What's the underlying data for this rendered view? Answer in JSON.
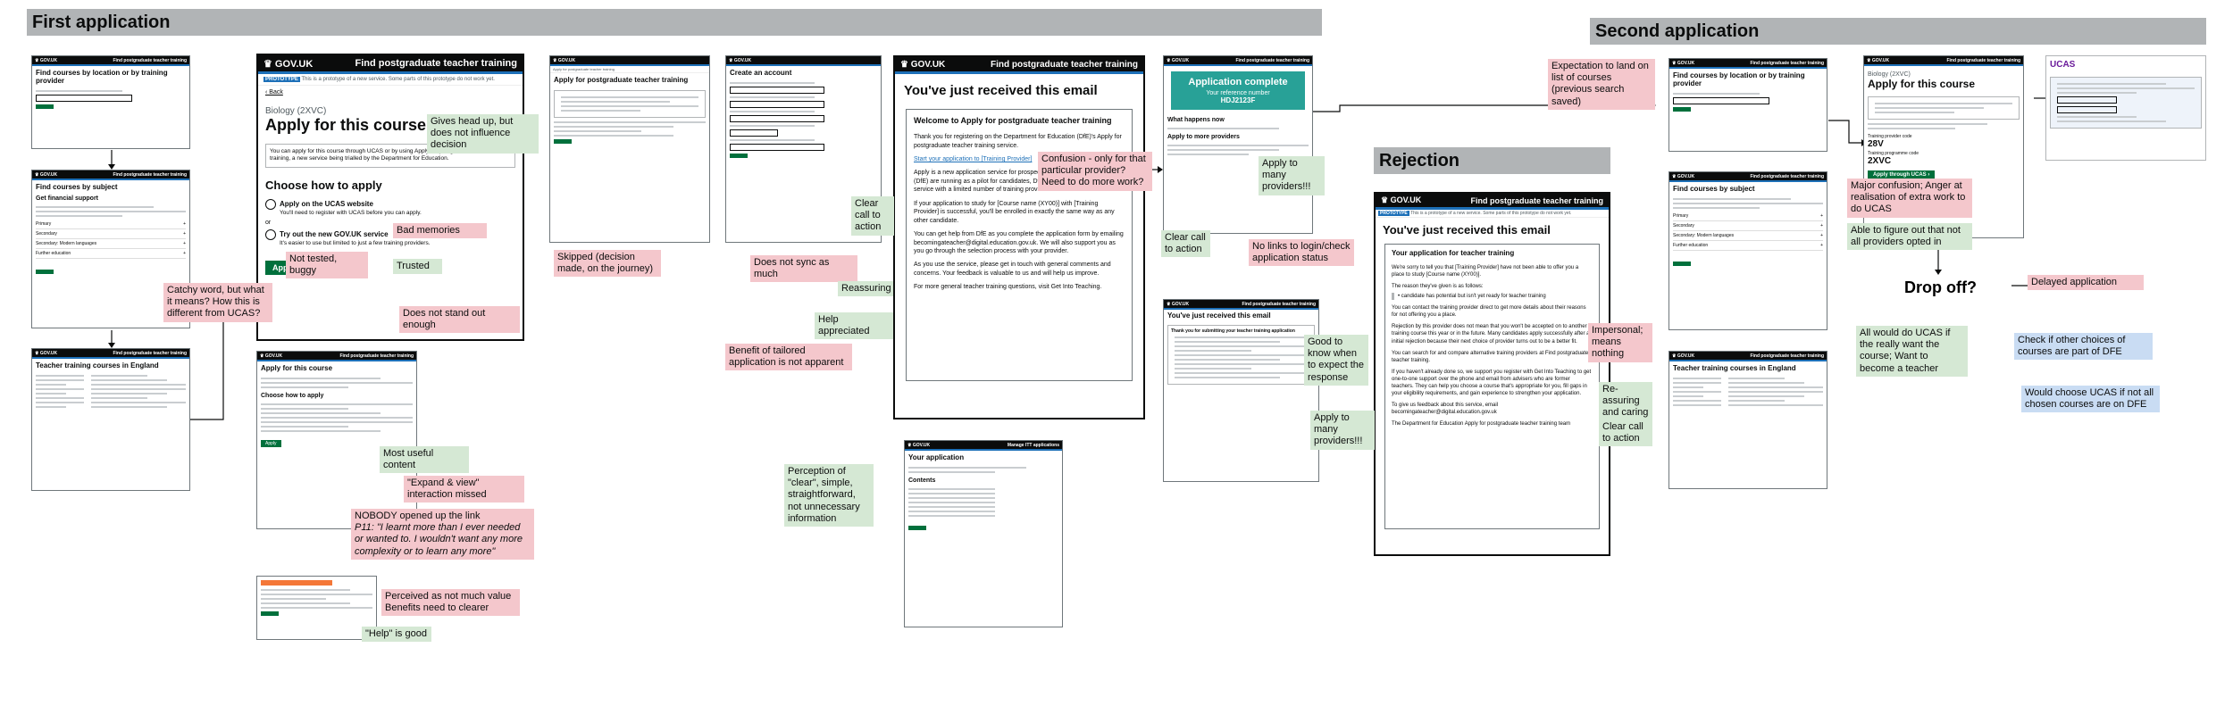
{
  "sections": {
    "first": "First application",
    "second": "Second application",
    "rejection": "Rejection"
  },
  "screens": {
    "s1_service": "Find postgraduate teacher training",
    "s1_title": "Find courses by location or by training provider",
    "s2_title": "Find courses by subject",
    "s2_sub": "Get financial support",
    "s2_rows": [
      "Primary",
      "Secondary",
      "Secondary: Modern languages",
      "Further education"
    ],
    "s3_title": "Teacher training courses in England",
    "main_logo": "GOV.UK",
    "main_service": "Find postgraduate teacher training",
    "main_proto_tag": "PROTOTYPE",
    "main_proto": "This is a prototype of a new service. Some parts of this prototype do not work yet.",
    "main_back": "‹ Back",
    "main_caption": "Biology (2XVC)",
    "main_title": "Apply for this course",
    "main_intro": "You can apply for this course through UCAS or by using Apply for postgraduate teacher training, a new service being trialled by the Department for Education.",
    "main_choose": "Choose how to apply",
    "main_opt1": "Apply on the UCAS website",
    "main_opt1_hint": "You'll need to register with UCAS before you can apply.",
    "main_or": "or",
    "main_opt2": "Try out the new GOV.UK service",
    "main_opt2_hint": "It's easier to use but limited to just a few training providers.",
    "main_apply": "Apply ›",
    "s5_title": "Apply for this course",
    "s5_choose": "Choose how to apply",
    "s5_apply": "Apply",
    "s7_title": "Apply for postgraduate teacher training",
    "s8_title": "Create an account",
    "email_logo": "GOV.UK",
    "email_service": "Find postgraduate teacher training",
    "email_title": "You've just received this email",
    "email_h": "Welcome to Apply for postgraduate teacher training",
    "email_p1": "Thank you for registering on the Department for Education (DfE)'s Apply for postgraduate teacher training service.",
    "email_link": "Start your application to [Training Provider]",
    "email_p2": "Apply is a new application service for prospective trainee teachers which we (DfE) are running as a pilot for candidates, DfE is running a pilot of the service with a limited number of training providers to test its effectiveness.",
    "email_p3": "If your application to study for [Course name (XY00)] with [Training Provider] is successful, you'll be enrolled in exactly the same way as any other candidate.",
    "email_p4": "You can get help from DfE as you complete the application form by emailing becomingateacher@digital.education.gov.uk. We will also support you as you go through the selection process with your provider.",
    "email_p5": "As you use the service, please get in touch with general comments and concerns. Your feedback is valuable to us and will help us improve.",
    "email_p6": "For more general teacher training questions, visit Get Into Teaching.",
    "complete_title": "Application complete",
    "complete_ref_label": "Your reference number",
    "complete_ref": "HDJ2123F",
    "complete_next": "What happens now",
    "complete_more": "Apply to more providers",
    "email2_title": "You've just received this email",
    "email2_h": "Thank you for submitting your teacher training application",
    "s11_title": "Your application",
    "s11_banner": "Manage ITT applications",
    "s11_contents": "Contents",
    "rej_logo": "GOV.UK",
    "rej_service": "Find postgraduate teacher training",
    "rej_title": "You've just received this email",
    "rej_h": "Your application for teacher training",
    "rej_p1": "We're sorry to tell you that [Training Provider] have not been able to offer you a place to study [Course name (XY00)].",
    "rej_p2": "The reason they've given is as follows:",
    "rej_reason": "candidate has potential but isn't yet ready for teacher training",
    "rej_p3": "You can contact the training provider direct to get more details about their reasons for not offering you a place.",
    "rej_p4": "Rejection by this provider does not mean that you won't be accepted on to another training course this year or in the future. Many candidates apply successfully after an initial rejection because their next choice of provider turns out to be a better fit.",
    "rej_p5": "You can search for and compare alternative training providers at Find postgraduate teacher training.",
    "rej_p6": "If you haven't already done so, we support you register with Get Into Teaching to get one-to-one support over the phone and email from advisers who are former teachers. They can help you choose a course that's appropriate for you, fill gaps in your eligibility requirements, and gain experience to strengthen your application.",
    "rej_p7": "To give us feedback about this service, email becomingateacher@digital.education.gov.uk",
    "rej_p8": "The Department for Education Apply for postgraduate teacher training team",
    "sa1_title": "Find courses by location or by training provider",
    "sa2_title": "Find courses by subject",
    "sa3_title": "Teacher training courses in England",
    "sa4_caption": "Biology (2XVC)",
    "sa4_title": "Apply for this course",
    "sa4_code_label": "Training provider code",
    "sa4_code1": "28V",
    "sa4_code2_label": "Training programme code",
    "sa4_code2": "2XVC",
    "sa4_btn": "Apply through UCAS ›",
    "ucas_logo": "UCAS",
    "drop_off": "Drop off?"
  },
  "notes": [
    "Gives head up, but does not influence decision",
    "Bad memories",
    "Not tested, buggy",
    "Trusted",
    "Does not stand out enough",
    "Catchy word, but what it means? How this is different from UCAS?",
    "Most useful content",
    "\"Expand & view\" interaction missed",
    "NOBODY opened up the link",
    "P11: \"I learnt more than I ever needed or wanted to. I wouldn't want any more complexity or to learn any more\"",
    "Perceived as not much value",
    "Benefits need to clearer",
    "\"Help\" is good",
    "Skipped (decision made, on the journey)",
    "Does not sync as much",
    "Reassuring",
    "Help appreciated",
    "Benefit of tailored application is not apparent",
    "Confusion - only for that particular provider? Need to do more work?",
    "Clear call to action",
    "Apply to many providers!!!",
    "Clear call to action",
    "No links to login/check application status",
    "Good to know when to expect the response",
    "Apply to many providers!!!",
    "Perception of \"clear\", simple, straightforward, not unnecessary information",
    "Impersonal; means nothing",
    "Re-assuring and caring",
    "Clear call to action",
    "Expectation to land on list of courses (previous search saved)",
    "Major confusion; Anger at realisation of extra work to do UCAS",
    "Able to figure out that not all providers opted in",
    "Delayed application",
    "All would do UCAS if the really want the course; Want to become a teacher",
    "Check if other choices of courses are part of DFE",
    "Would choose UCAS if not all chosen courses are on DFE"
  ],
  "colors": {
    "pink": "#f4c7cc",
    "green": "#d5e8d4",
    "blue": "#c9dcf3",
    "gov_green": "#00703c",
    "gov_black": "#0b0c0c",
    "gov_blue": "#1d70b8",
    "teal": "#28a197"
  }
}
